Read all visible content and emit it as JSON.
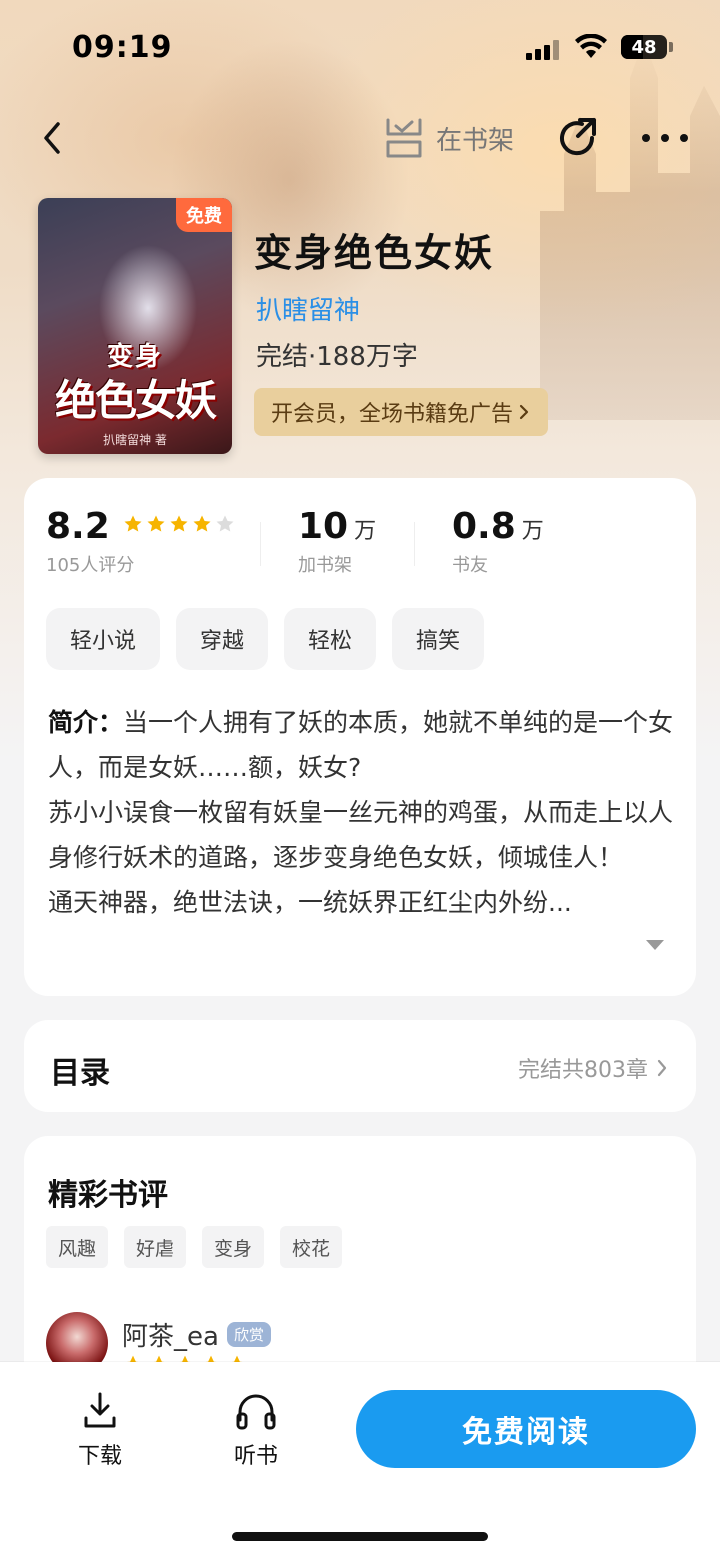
{
  "status_bar": {
    "time": "09:19",
    "battery": "48"
  },
  "nav": {
    "shelf_label": "在书架"
  },
  "book": {
    "title": "变身绝色女妖",
    "author": "扒瞎留神",
    "meta": "完结·188万字",
    "free_badge": "免费",
    "cover_title_small": "变身",
    "cover_title_large": "绝色女妖",
    "cover_author": "扒瞎留神 著",
    "vip_promo": "开会员，全场书籍免广告"
  },
  "stats": {
    "rating": "8.2",
    "rating_stars": 4,
    "rating_count": "105人评分",
    "shelf_count": "10",
    "shelf_unit": "万",
    "shelf_label": "加书架",
    "friends_count": "0.8",
    "friends_unit": "万",
    "friends_label": "书友"
  },
  "tags": [
    "轻小说",
    "穿越",
    "轻松",
    "搞笑"
  ],
  "intro": {
    "label": "简介：",
    "line1": "当一个人拥有了妖的本质，她就不单纯的是一个女人，而是女妖……额，妖女?",
    "line2": "苏小小误食一枚留有妖皇一丝元神的鸡蛋，从而走上以人身修行妖术的道路，逐步变身绝色女妖，倾城佳人！",
    "line3": "通天神器，绝世法诀，一统妖界正红尘内外纷..."
  },
  "toc": {
    "title": "目录",
    "count": "完结共803章"
  },
  "reviews": {
    "title": "精彩书评",
    "tags": [
      "风趣",
      "好虐",
      "变身",
      "校花"
    ],
    "first": {
      "user": "阿茶_ea",
      "badge": "欣赏",
      "stars": 5
    }
  },
  "bottom_bar": {
    "download": "下载",
    "listen": "听书",
    "read": "免费阅读"
  },
  "colors": {
    "accent": "#1a9bf0",
    "link": "#2b8fe6",
    "star": "#f6b400",
    "free": "#ff6a3d"
  }
}
